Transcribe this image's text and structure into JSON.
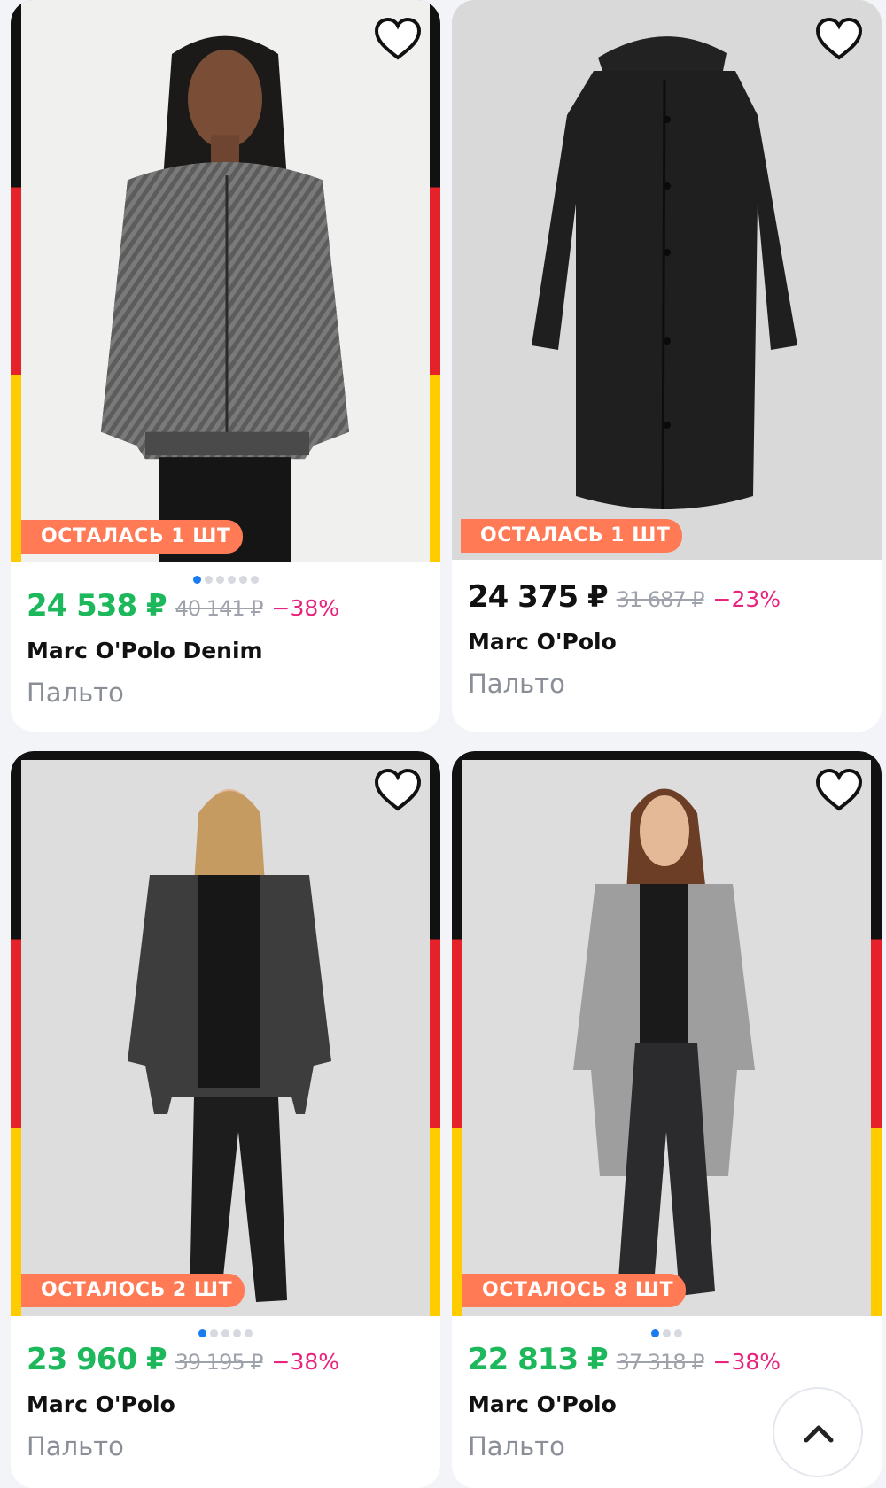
{
  "products": [
    {
      "stock_label": "ОСТАЛАСЬ 1 ШТ",
      "price": "24 538 ₽",
      "old_price": "40 141 ₽",
      "discount": "−38%",
      "brand": "Marc O'Polo Denim",
      "category": "Пальто",
      "price_color": "#1eb85c",
      "favorite_icon": "heart-outline-icon"
    },
    {
      "stock_label": "ОСТАЛАСЬ 1 ШТ",
      "price": "24 375 ₽",
      "old_price": "31 687 ₽",
      "discount": "−23%",
      "brand": "Marc O'Polo",
      "category": "Пальто",
      "price_color": "#111111",
      "favorite_icon": "heart-outline-icon"
    },
    {
      "stock_label": "ОСТАЛОСЬ 2 ШТ",
      "price": "23 960 ₽",
      "old_price": "39 195 ₽",
      "discount": "−38%",
      "brand": "Marc O'Polo",
      "category": "Пальто",
      "price_color": "#1eb85c",
      "favorite_icon": "heart-outline-icon"
    },
    {
      "stock_label": "ОСТАЛОСЬ 8 ШТ",
      "price": "22 813 ₽",
      "old_price": "37 318 ₽",
      "discount": "−38%",
      "brand": "Marc O'Polo",
      "category": "Пальто",
      "price_color": "#1eb85c",
      "favorite_icon": "heart-outline-icon"
    }
  ],
  "colors": {
    "page_bg": "#f3f4f8",
    "badge": "#ff7a55",
    "discount": "#e8227d",
    "flag_black": "#111111",
    "flag_red": "#e52229",
    "flag_gold": "#ffcc00",
    "carousel_active": "#1b7cf0"
  },
  "scroll_top_icon": "chevron-up-icon"
}
